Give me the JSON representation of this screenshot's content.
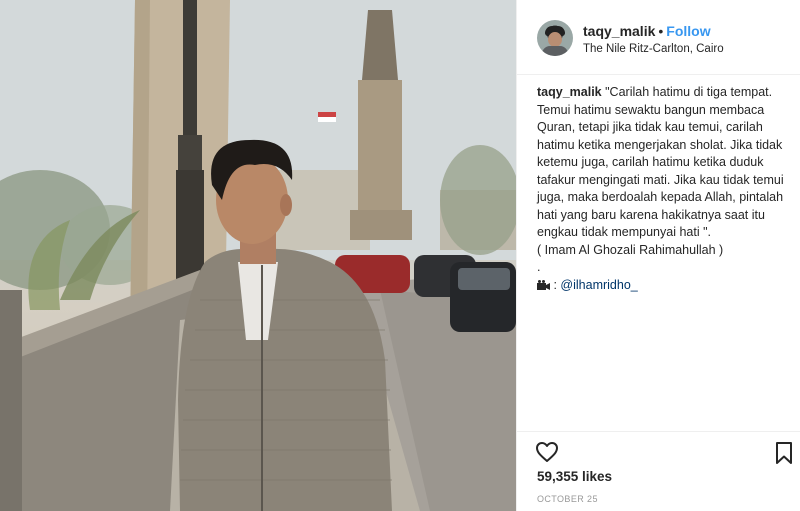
{
  "post": {
    "photo": {
      "description_icon": "photo"
    },
    "header": {
      "username": "taqy_malik",
      "separator": "•",
      "follow_label": "Follow",
      "location": "The Nile Ritz-Carlton, Cairo"
    },
    "caption": {
      "username": "taqy_malik",
      "text": "\"Carilah hatimu di tiga tempat. Temui hatimu sewaktu bangun membaca Quran, tetapi jika tidak kau temui, carilah hatimu ketika mengerjakan sholat. Jika tidak ketemu juga, carilah hatimu ketika duduk tafakur mengingati mati. Jika kau tidak temui juga, maka berdoalah kepada Allah, pintalah hati yang baru karena hakikatnya saat itu engkau tidak mempunyai hati \".\n( Imam Al Ghozali Rahimahullah )\n.",
      "credit_prefix": " : ",
      "credit_mention": "@ilhamridho_"
    },
    "actions": {
      "like_icon": "heart-icon",
      "save_icon": "bookmark-icon",
      "likes": "59,355 likes",
      "date": "OCTOBER 25"
    },
    "colors": {
      "link_blue": "#3897f0",
      "mention": "#003569",
      "text": "#262626",
      "muted": "#999999",
      "border": "#efefef"
    }
  }
}
